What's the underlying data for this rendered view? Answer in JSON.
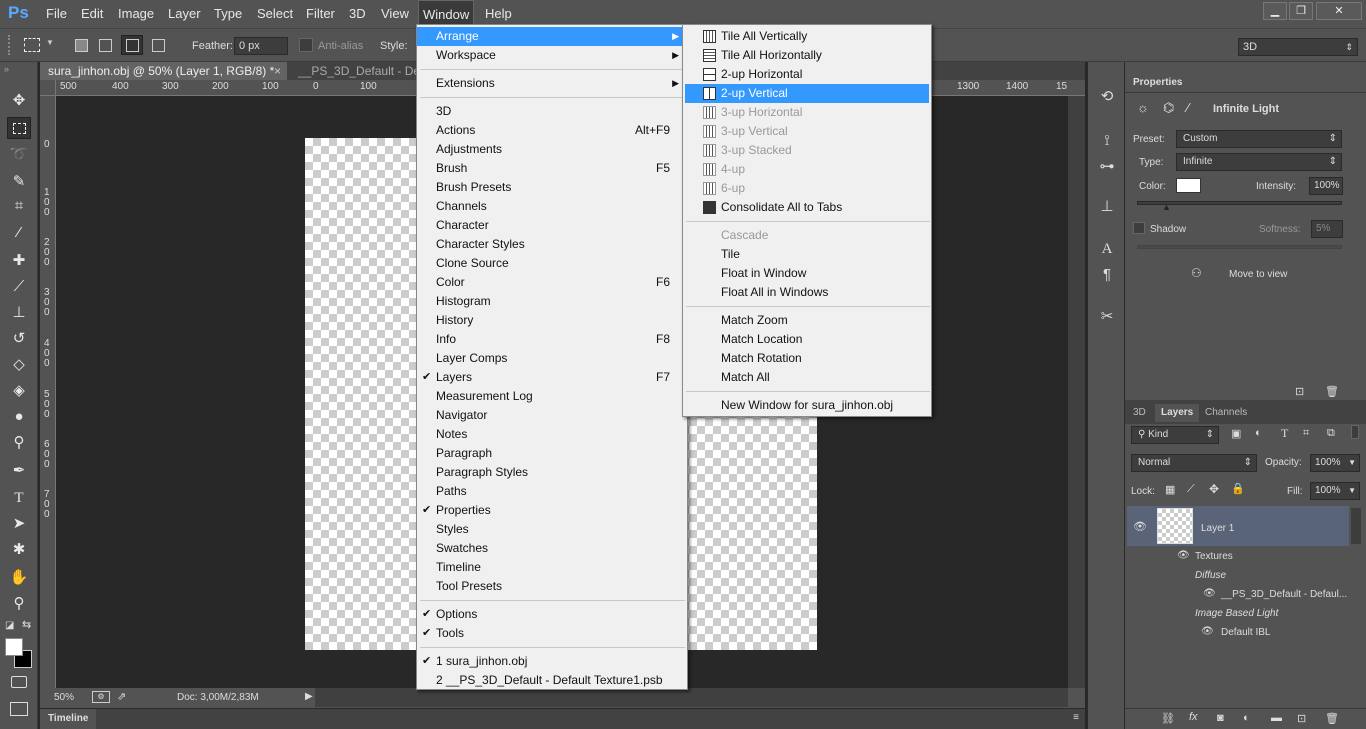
{
  "app": {
    "logo": "Ps"
  },
  "menubar": {
    "items": [
      "File",
      "Edit",
      "Image",
      "Layer",
      "Type",
      "Select",
      "Filter",
      "3D",
      "View",
      "Window",
      "Help"
    ],
    "active": "Window"
  },
  "window_controls": {
    "minimize": "▁",
    "restore": "❐",
    "close": "✕"
  },
  "options": {
    "feather_label": "Feather:",
    "feather_value": "0 px",
    "antialias_label": "Anti-alias",
    "style_label": "Style:",
    "workspace_value": "3D"
  },
  "doc_tabs": [
    {
      "label": "sura_jinhon.obj @ 50% (Layer 1, RGB/8) *",
      "close": "×"
    },
    {
      "label": "__PS_3D_Default - Defa",
      "close": ""
    }
  ],
  "ruler": {
    "top": [
      "500",
      "400",
      "300",
      "200",
      "100",
      "0",
      "100",
      "1300",
      "1400",
      "15"
    ],
    "left": [
      "0",
      "1\n0\n0",
      "2\n0\n0",
      "3\n0\n0",
      "4\n0\n0",
      "5\n0\n0",
      "6\n0\n0",
      "7\n0\n0"
    ]
  },
  "status": {
    "zoom": "50%",
    "doc": "Doc: 3,00M/2,83M"
  },
  "timeline": {
    "label": "Timeline"
  },
  "window_menu": {
    "items": [
      {
        "label": "Arrange",
        "submenu": true,
        "highlight": true
      },
      {
        "label": "Workspace",
        "submenu": true
      },
      {
        "sep": true
      },
      {
        "label": "Extensions",
        "submenu": true
      },
      {
        "sep": true
      },
      {
        "label": "3D"
      },
      {
        "label": "Actions",
        "shortcut": "Alt+F9"
      },
      {
        "label": "Adjustments"
      },
      {
        "label": "Brush",
        "shortcut": "F5"
      },
      {
        "label": "Brush Presets"
      },
      {
        "label": "Channels"
      },
      {
        "label": "Character"
      },
      {
        "label": "Character Styles"
      },
      {
        "label": "Clone Source"
      },
      {
        "label": "Color",
        "shortcut": "F6"
      },
      {
        "label": "Histogram"
      },
      {
        "label": "History"
      },
      {
        "label": "Info",
        "shortcut": "F8"
      },
      {
        "label": "Layer Comps"
      },
      {
        "label": "Layers",
        "shortcut": "F7",
        "checked": true
      },
      {
        "label": "Measurement Log"
      },
      {
        "label": "Navigator"
      },
      {
        "label": "Notes"
      },
      {
        "label": "Paragraph"
      },
      {
        "label": "Paragraph Styles"
      },
      {
        "label": "Paths"
      },
      {
        "label": "Properties",
        "checked": true
      },
      {
        "label": "Styles"
      },
      {
        "label": "Swatches"
      },
      {
        "label": "Timeline"
      },
      {
        "label": "Tool Presets"
      },
      {
        "sep": true
      },
      {
        "label": "Options",
        "checked": true
      },
      {
        "label": "Tools",
        "checked": true
      },
      {
        "sep": true
      },
      {
        "label": "1 sura_jinhon.obj",
        "checked": true
      },
      {
        "label": "2 __PS_3D_Default - Default Texture1.psb"
      }
    ]
  },
  "arrange_menu": {
    "items": [
      {
        "label": "Tile All Vertically",
        "icon": "tile-vertical-icon"
      },
      {
        "label": "Tile All Horizontally",
        "icon": "tile-horizontal-icon"
      },
      {
        "label": "2-up Horizontal",
        "icon": "two-up-horizontal-icon"
      },
      {
        "label": "2-up Vertical",
        "icon": "two-up-vertical-icon",
        "highlight": true
      },
      {
        "label": "3-up Horizontal",
        "icon": "three-up-horizontal-icon",
        "disabled": true
      },
      {
        "label": "3-up Vertical",
        "icon": "three-up-vertical-icon",
        "disabled": true
      },
      {
        "label": "3-up Stacked",
        "icon": "three-up-stacked-icon",
        "disabled": true
      },
      {
        "label": "4-up",
        "icon": "four-up-icon",
        "disabled": true
      },
      {
        "label": "6-up",
        "icon": "six-up-icon",
        "disabled": true
      },
      {
        "label": "Consolidate All to Tabs",
        "icon": "consolidate-tabs-icon"
      },
      {
        "sep": true
      },
      {
        "label": "Cascade",
        "disabled": true
      },
      {
        "label": "Tile"
      },
      {
        "label": "Float in Window"
      },
      {
        "label": "Float All in Windows"
      },
      {
        "sep": true
      },
      {
        "label": "Match Zoom"
      },
      {
        "label": "Match Location"
      },
      {
        "label": "Match Rotation"
      },
      {
        "label": "Match All"
      },
      {
        "sep": true
      },
      {
        "label": "New Window for sura_jinhon.obj"
      }
    ]
  },
  "properties": {
    "tab": "Properties",
    "title": "Infinite Light",
    "preset_label": "Preset:",
    "preset_value": "Custom",
    "type_label": "Type:",
    "type_value": "Infinite",
    "color_label": "Color:",
    "color_value": "#ffffff",
    "intensity_label": "Intensity:",
    "intensity_value": "100%",
    "shadow_label": "Shadow",
    "softness_label": "Softness:",
    "softness_value": "5%",
    "move_to_view": "Move to view"
  },
  "layers": {
    "tabs": [
      "3D",
      "Layers",
      "Channels"
    ],
    "active_tab": "Layers",
    "kind": "Kind",
    "blend": "Normal",
    "opacity_label": "Opacity:",
    "opacity_value": "100%",
    "lock_label": "Lock:",
    "fill_label": "Fill:",
    "fill_value": "100%",
    "layer_name": "Layer 1",
    "textures": "Textures",
    "diffuse": "Diffuse",
    "diffuse_item": "__PS_3D_Default - Defaul...",
    "ibl": "Image Based Light",
    "ibl_item": "Default IBL"
  }
}
